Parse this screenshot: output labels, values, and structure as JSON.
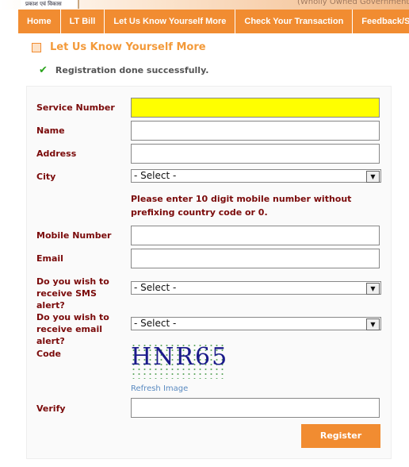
{
  "header": {
    "logo_text": "प्रकाश एवं विकास",
    "tagline": "(Wholly Owned Government of"
  },
  "nav": [
    "Home",
    "LT Bill",
    "Let Us Know Yourself More",
    "Check Your Transaction",
    "Feedback/S"
  ],
  "page_title": "Let Us Know Yourself More",
  "success_message": "Registration done successfully.",
  "form": {
    "service_number": "Service Number",
    "name": "Name",
    "address": "Address",
    "city": "City",
    "city_value": "- Select -",
    "mobile_note": "Please enter 10 digit mobile number without prefixing country code or 0.",
    "mobile": "Mobile Number",
    "email": "Email",
    "sms_alert": "Do you wish to receive SMS alert?",
    "sms_value": "- Select -",
    "email_alert": "Do you wish to receive email alert?",
    "email_alert_value": "- Select -",
    "code": "Code",
    "captcha": "HNR65",
    "refresh": "Refresh Image",
    "verify": "Verify",
    "register": "Register"
  },
  "colors": {
    "accent": "#f18c31",
    "label": "#7a0a0a",
    "highlight": "#ffff00"
  }
}
